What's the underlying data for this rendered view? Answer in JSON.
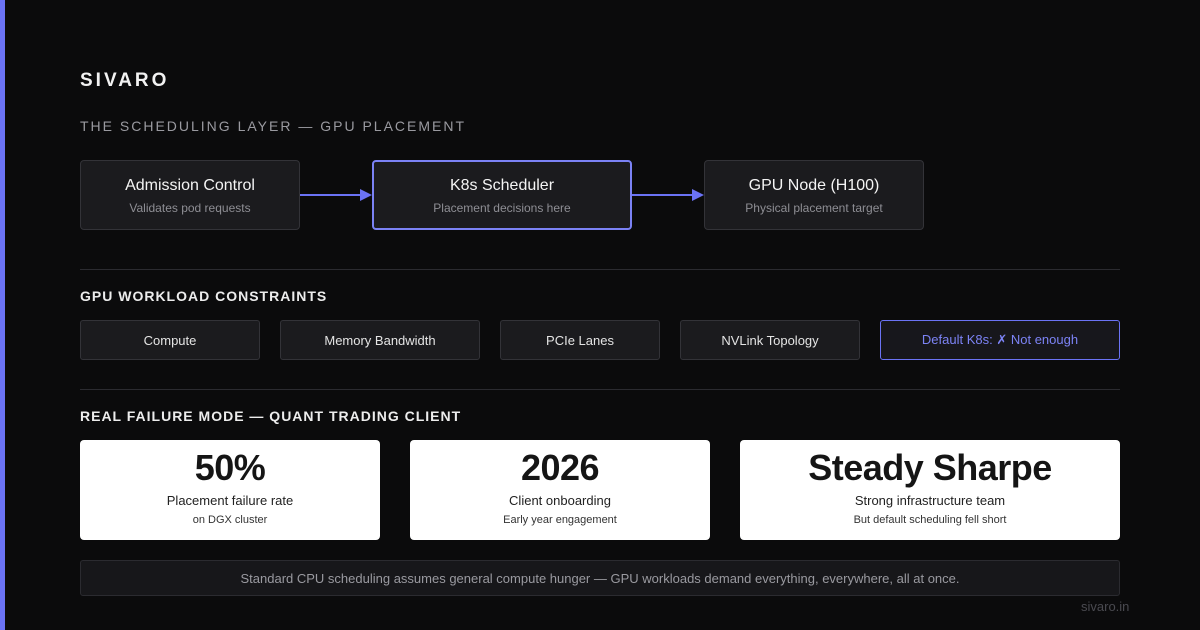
{
  "brand": "SIVARO",
  "subtitle": "THE SCHEDULING LAYER — GPU PLACEMENT",
  "flow": [
    {
      "title": "Admission Control",
      "desc": "Validates pod requests"
    },
    {
      "title": "K8s Scheduler",
      "desc": "Placement decisions here"
    },
    {
      "title": "GPU Node (H100)",
      "desc": "Physical placement target"
    }
  ],
  "constraints": {
    "title": "GPU WORKLOAD CONSTRAINTS",
    "items": [
      "Compute",
      "Memory Bandwidth",
      "PCIe Lanes",
      "NVLink Topology",
      "Default K8s: ✗ Not enough"
    ]
  },
  "failure": {
    "title": "REAL FAILURE MODE — QUANT TRADING CLIENT",
    "stats": [
      {
        "value": "50%",
        "label": "Placement failure rate",
        "note": "on DGX cluster"
      },
      {
        "value": "2026",
        "label": "Client onboarding",
        "note": "Early year engagement"
      },
      {
        "value": "Steady Sharpe",
        "label": "Strong infrastructure team",
        "note": "But default scheduling fell short"
      }
    ]
  },
  "footer_note": "Standard CPU scheduling assumes general compute hunger — GPU workloads demand everything, everywhere, all at once.",
  "site": "sivaro.in",
  "colors": {
    "accent": "#6b73f5",
    "background": "#0b0b0c",
    "card": "#ffffff"
  }
}
